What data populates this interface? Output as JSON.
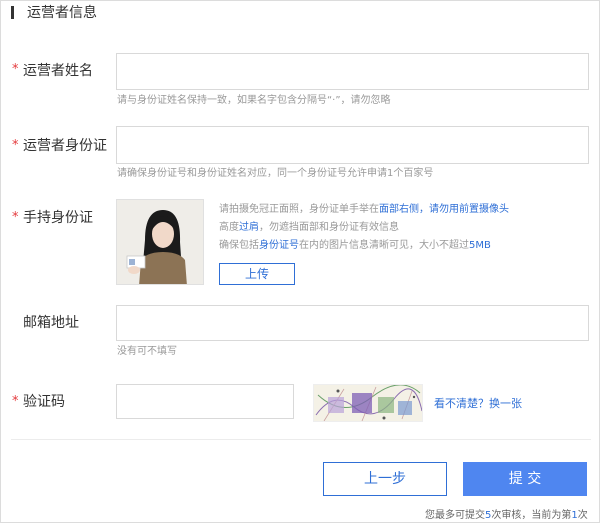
{
  "section": {
    "title": "运营者信息"
  },
  "fields": {
    "name": {
      "required_mark": "*",
      "label": "运营者姓名",
      "value": "",
      "hint": "请与身份证姓名保持一致，如果名字包含分隔号“·”，请勿忽略"
    },
    "id_card": {
      "required_mark": "*",
      "label": "运营者身份证",
      "value": "",
      "hint": "请确保身份证号和身份证姓名对应，同一个身份证号允许申请1个百家号"
    },
    "id_photo": {
      "required_mark": "*",
      "label": "手持身份证",
      "note1": {
        "a": "请拍摄免冠正面照，身份证单手举在",
        "b": "面部右侧",
        "c": "，请勿用前置摄像头"
      },
      "note2": {
        "a": "高度",
        "b": "过肩",
        "c": "，勿遮挡面部和身份证有效信息"
      },
      "note3": {
        "a": "确保包括",
        "b": "身份证号",
        "c": "在内的图片信息清晰可见，大小不超过",
        "d": "5MB"
      },
      "upload_label": "上传"
    },
    "email": {
      "label": "邮箱地址",
      "value": "",
      "hint": "没有可不填写"
    },
    "captcha": {
      "required_mark": "*",
      "label": "验证码",
      "value": "",
      "refresh_label": "看不清楚？换一张"
    }
  },
  "actions": {
    "prev_label": "上一步",
    "submit_label": "提 交"
  },
  "footer": {
    "a": "您最多可提交",
    "count": "5",
    "b": "次审核，当前为第",
    "current": "1",
    "c": "次"
  },
  "colors": {
    "accent": "#2f6fd6",
    "submit": "#4f86f0",
    "required": "#e4393c"
  }
}
